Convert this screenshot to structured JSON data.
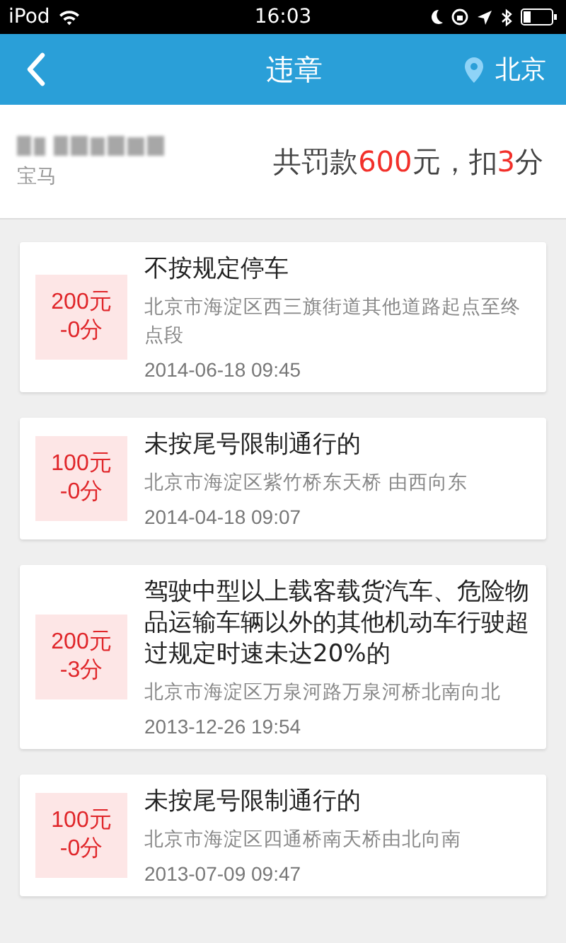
{
  "status_bar": {
    "carrier": "iPod",
    "time": "16:03"
  },
  "nav": {
    "title": "违章",
    "city": "北京"
  },
  "summary": {
    "car_model": "宝马",
    "parts": [
      {
        "text": "共罚款",
        "highlight": false
      },
      {
        "text": "600",
        "highlight": true
      },
      {
        "text": "元，扣",
        "highlight": false
      },
      {
        "text": "3",
        "highlight": true
      },
      {
        "text": "分",
        "highlight": false
      }
    ]
  },
  "violations": [
    {
      "fine": "200元",
      "points": "-0分",
      "title": "不按规定停车",
      "address": "北京市海淀区西三旗街道其他道路起点至终点段",
      "time": "2014-06-18 09:45"
    },
    {
      "fine": "100元",
      "points": "-0分",
      "title": "未按尾号限制通行的",
      "address": "北京市海淀区紫竹桥东天桥 由西向东",
      "time": "2014-04-18 09:07"
    },
    {
      "fine": "200元",
      "points": "-3分",
      "title": "驾驶中型以上载客载货汽车、危险物品运输车辆以外的其他机动车行驶超过规定时速未达20%的",
      "address": "北京市海淀区万泉河路万泉河桥北南向北",
      "time": "2013-12-26 19:54"
    },
    {
      "fine": "100元",
      "points": "-0分",
      "title": "未按尾号限制通行的",
      "address": "北京市海淀区四通桥南天桥由北向南",
      "time": "2013-07-09 09:47"
    }
  ]
}
